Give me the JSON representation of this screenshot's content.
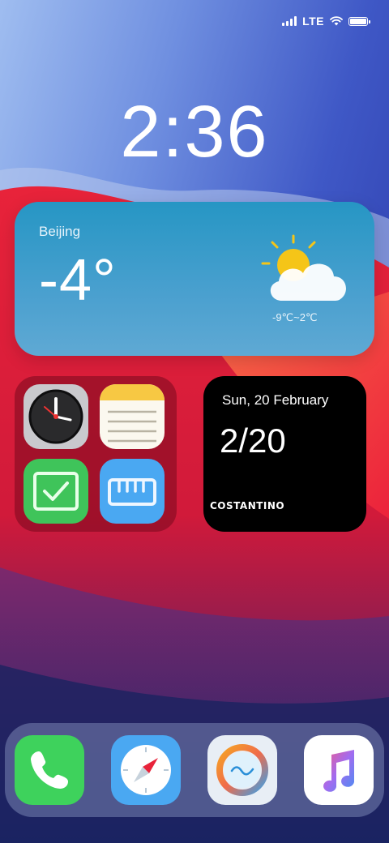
{
  "status_bar": {
    "network": "LTE"
  },
  "clock": {
    "time": "2:36"
  },
  "weather": {
    "city": "Beijing",
    "temperature": "-4°",
    "range": "-9℃~2℃",
    "condition_icon": "partly-cloudy-icon"
  },
  "folder": {
    "apps": [
      {
        "icon": "clock-app-icon"
      },
      {
        "icon": "notes-app-icon"
      },
      {
        "icon": "reminders-app-icon"
      },
      {
        "icon": "ruler-app-icon"
      }
    ]
  },
  "calendar": {
    "date_line": "Sun, 20 February",
    "big_date": "2/20",
    "name": "COSTANTINO"
  },
  "dock": {
    "apps": [
      {
        "icon": "phone-app-icon",
        "color": "#3ed25c"
      },
      {
        "icon": "safari-app-icon",
        "color": "#4aa8f2"
      },
      {
        "icon": "weather-app-icon",
        "color": "#e8eef5"
      },
      {
        "icon": "music-app-icon",
        "color": "#ffffff"
      }
    ]
  },
  "colors": {
    "accent_red": "#e8233a",
    "sky_blue": "#3a5ed0",
    "weather_widget": "#2696c4"
  }
}
